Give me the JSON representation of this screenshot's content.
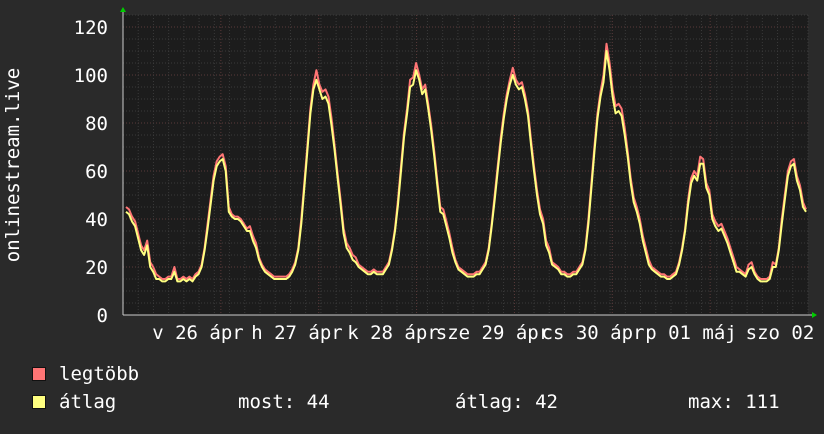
{
  "chart_data": {
    "type": "line",
    "title": "",
    "ylabel": "onlinestream.live",
    "xlabel": "",
    "ylim": [
      0,
      125
    ],
    "yticks": [
      0,
      20,
      40,
      60,
      80,
      100,
      120
    ],
    "x_tick_labels": [
      "v 26 ápr",
      "h 27 ápr",
      "k 28 ápr",
      "sze 29 ápr",
      "cs 30 ápr",
      "p 01 máj",
      "szo 02"
    ],
    "grid": true,
    "legend_position": "bottom-left",
    "background_color": "#2a2a2a",
    "plot_background": "#1c1c1c",
    "series": [
      {
        "name": "legtöbb",
        "color": "#ff7575",
        "values": [
          45,
          44,
          41,
          39,
          34,
          29,
          27,
          31,
          22,
          20,
          17,
          16,
          15,
          15,
          16,
          16,
          20,
          15,
          15,
          16,
          15,
          16,
          15,
          17,
          18,
          21,
          28,
          38,
          48,
          58,
          64,
          66,
          67,
          62,
          45,
          42,
          41,
          41,
          40,
          38,
          36,
          37,
          33,
          30,
          24,
          21,
          19,
          18,
          17,
          16,
          16,
          16,
          16,
          16,
          17,
          19,
          22,
          28,
          40,
          55,
          70,
          86,
          96,
          102,
          96,
          93,
          94,
          91,
          82,
          71,
          59,
          48,
          36,
          30,
          28,
          25,
          24,
          21,
          20,
          19,
          18,
          18,
          19,
          18,
          18,
          18,
          20,
          22,
          28,
          36,
          48,
          62,
          76,
          86,
          98,
          99,
          105,
          100,
          94,
          96,
          88,
          79,
          68,
          56,
          45,
          44,
          39,
          34,
          28,
          23,
          20,
          19,
          18,
          17,
          17,
          17,
          18,
          18,
          20,
          22,
          28,
          38,
          50,
          62,
          74,
          84,
          92,
          98,
          103,
          98,
          96,
          97,
          92,
          85,
          73,
          62,
          52,
          44,
          40,
          31,
          28,
          22,
          21,
          20,
          18,
          18,
          17,
          17,
          18,
          18,
          20,
          22,
          28,
          40,
          55,
          70,
          84,
          93,
          100,
          113,
          105,
          94,
          87,
          88,
          86,
          78,
          68,
          57,
          49,
          45,
          40,
          33,
          28,
          23,
          20,
          19,
          18,
          17,
          17,
          16,
          16,
          17,
          18,
          22,
          28,
          36,
          48,
          57,
          60,
          58,
          66,
          65,
          55,
          52,
          42,
          39,
          37,
          38,
          35,
          32,
          28,
          24,
          20,
          19,
          18,
          17,
          21,
          22,
          18,
          16,
          15,
          15,
          15,
          16,
          22,
          21,
          28,
          40,
          50,
          60,
          64,
          65,
          58,
          54,
          47,
          44
        ]
      },
      {
        "name": "átlag",
        "color": "#ffff80",
        "values": [
          43,
          42,
          39,
          37,
          32,
          27,
          25,
          29,
          20,
          18,
          15,
          15,
          14,
          14,
          15,
          15,
          18,
          14,
          14,
          15,
          14,
          15,
          14,
          16,
          17,
          20,
          27,
          36,
          46,
          56,
          62,
          64,
          65,
          60,
          43,
          41,
          40,
          40,
          39,
          37,
          35,
          35,
          31,
          28,
          23,
          20,
          18,
          17,
          16,
          15,
          15,
          15,
          15,
          15,
          16,
          18,
          21,
          27,
          38,
          53,
          68,
          84,
          94,
          98,
          94,
          90,
          91,
          88,
          79,
          69,
          57,
          46,
          34,
          28,
          26,
          23,
          22,
          20,
          19,
          18,
          17,
          17,
          18,
          17,
          17,
          17,
          19,
          21,
          27,
          35,
          46,
          60,
          74,
          84,
          95,
          96,
          102,
          98,
          92,
          94,
          86,
          77,
          66,
          54,
          43,
          42,
          37,
          32,
          26,
          22,
          19,
          18,
          17,
          16,
          16,
          16,
          17,
          17,
          19,
          21,
          27,
          37,
          48,
          60,
          72,
          82,
          90,
          96,
          100,
          96,
          94,
          95,
          90,
          83,
          71,
          60,
          50,
          42,
          38,
          29,
          26,
          21,
          20,
          19,
          17,
          17,
          16,
          16,
          17,
          17,
          19,
          21,
          27,
          38,
          53,
          68,
          82,
          91,
          97,
          110,
          102,
          91,
          84,
          85,
          83,
          75,
          66,
          55,
          47,
          43,
          38,
          31,
          26,
          21,
          19,
          18,
          17,
          16,
          16,
          15,
          15,
          16,
          17,
          21,
          27,
          35,
          46,
          55,
          58,
          56,
          63,
          63,
          53,
          50,
          40,
          37,
          35,
          36,
          33,
          30,
          26,
          22,
          18,
          18,
          17,
          16,
          19,
          20,
          17,
          15,
          14,
          14,
          14,
          15,
          20,
          20,
          27,
          38,
          48,
          58,
          62,
          63,
          56,
          52,
          45,
          43
        ]
      }
    ]
  },
  "legend": [
    {
      "label": "legtöbb",
      "color": "#ff7575"
    },
    {
      "label": "átlag",
      "color": "#ffff80"
    }
  ],
  "stats": {
    "most": "most: 44",
    "atlag": "átlag: 42",
    "max": "max: 111"
  }
}
